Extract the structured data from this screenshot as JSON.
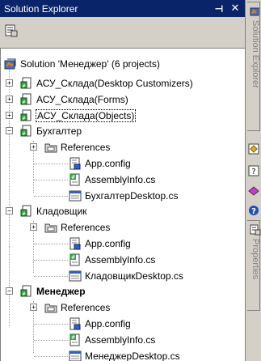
{
  "panel": {
    "title": "Solution Explorer",
    "pin_icon": "pin-icon",
    "close_icon": "close-icon"
  },
  "toolbar": {
    "properties_icon": "properties-icon"
  },
  "tree": {
    "solution": {
      "label": "Solution 'Менеджер' (6 projects)",
      "icon": "solution-icon"
    },
    "nodes": [
      {
        "label": "АСУ_Склада(Desktop Customizers)",
        "icon": "project-icon",
        "expander": "+"
      },
      {
        "label": "АСУ_Склада(Forms)",
        "icon": "project-icon",
        "expander": "+"
      },
      {
        "label": "АСУ_Склада(Objects)",
        "icon": "project-icon",
        "expander": "+"
      },
      {
        "label": "Бухгалтер",
        "icon": "project-icon",
        "expander": "−"
      },
      {
        "label": "References",
        "icon": "references-icon",
        "expander": "+"
      },
      {
        "label": "App.config",
        "icon": "config-file-icon"
      },
      {
        "label": "AssemblyInfo.cs",
        "icon": "cs-file-icon"
      },
      {
        "label": "БухгалтерDesktop.cs",
        "icon": "desktop-cs-icon"
      },
      {
        "label": "Кладовщик",
        "icon": "project-icon",
        "expander": "−"
      },
      {
        "label": "References",
        "icon": "references-icon",
        "expander": "+"
      },
      {
        "label": "App.config",
        "icon": "config-file-icon"
      },
      {
        "label": "AssemblyInfo.cs",
        "icon": "cs-file-icon"
      },
      {
        "label": "КладовщикDesktop.cs",
        "icon": "desktop-cs-icon"
      },
      {
        "label": "Менеджер",
        "icon": "project-icon",
        "expander": "−",
        "bold": true
      },
      {
        "label": "References",
        "icon": "references-icon",
        "expander": "+"
      },
      {
        "label": "App.config",
        "icon": "config-file-icon"
      },
      {
        "label": "AssemblyInfo.cs",
        "icon": "cs-file-icon"
      },
      {
        "label": "МенеджерDesktop.cs",
        "icon": "desktop-cs-icon"
      }
    ]
  },
  "side_strip": {
    "tab_solution_explorer": "Solution Explorer",
    "tab_properties": "Properties"
  },
  "colors": {
    "titlebar": "#0a246a",
    "face": "#d4d0c8",
    "tree_bg": "#ffffff"
  }
}
